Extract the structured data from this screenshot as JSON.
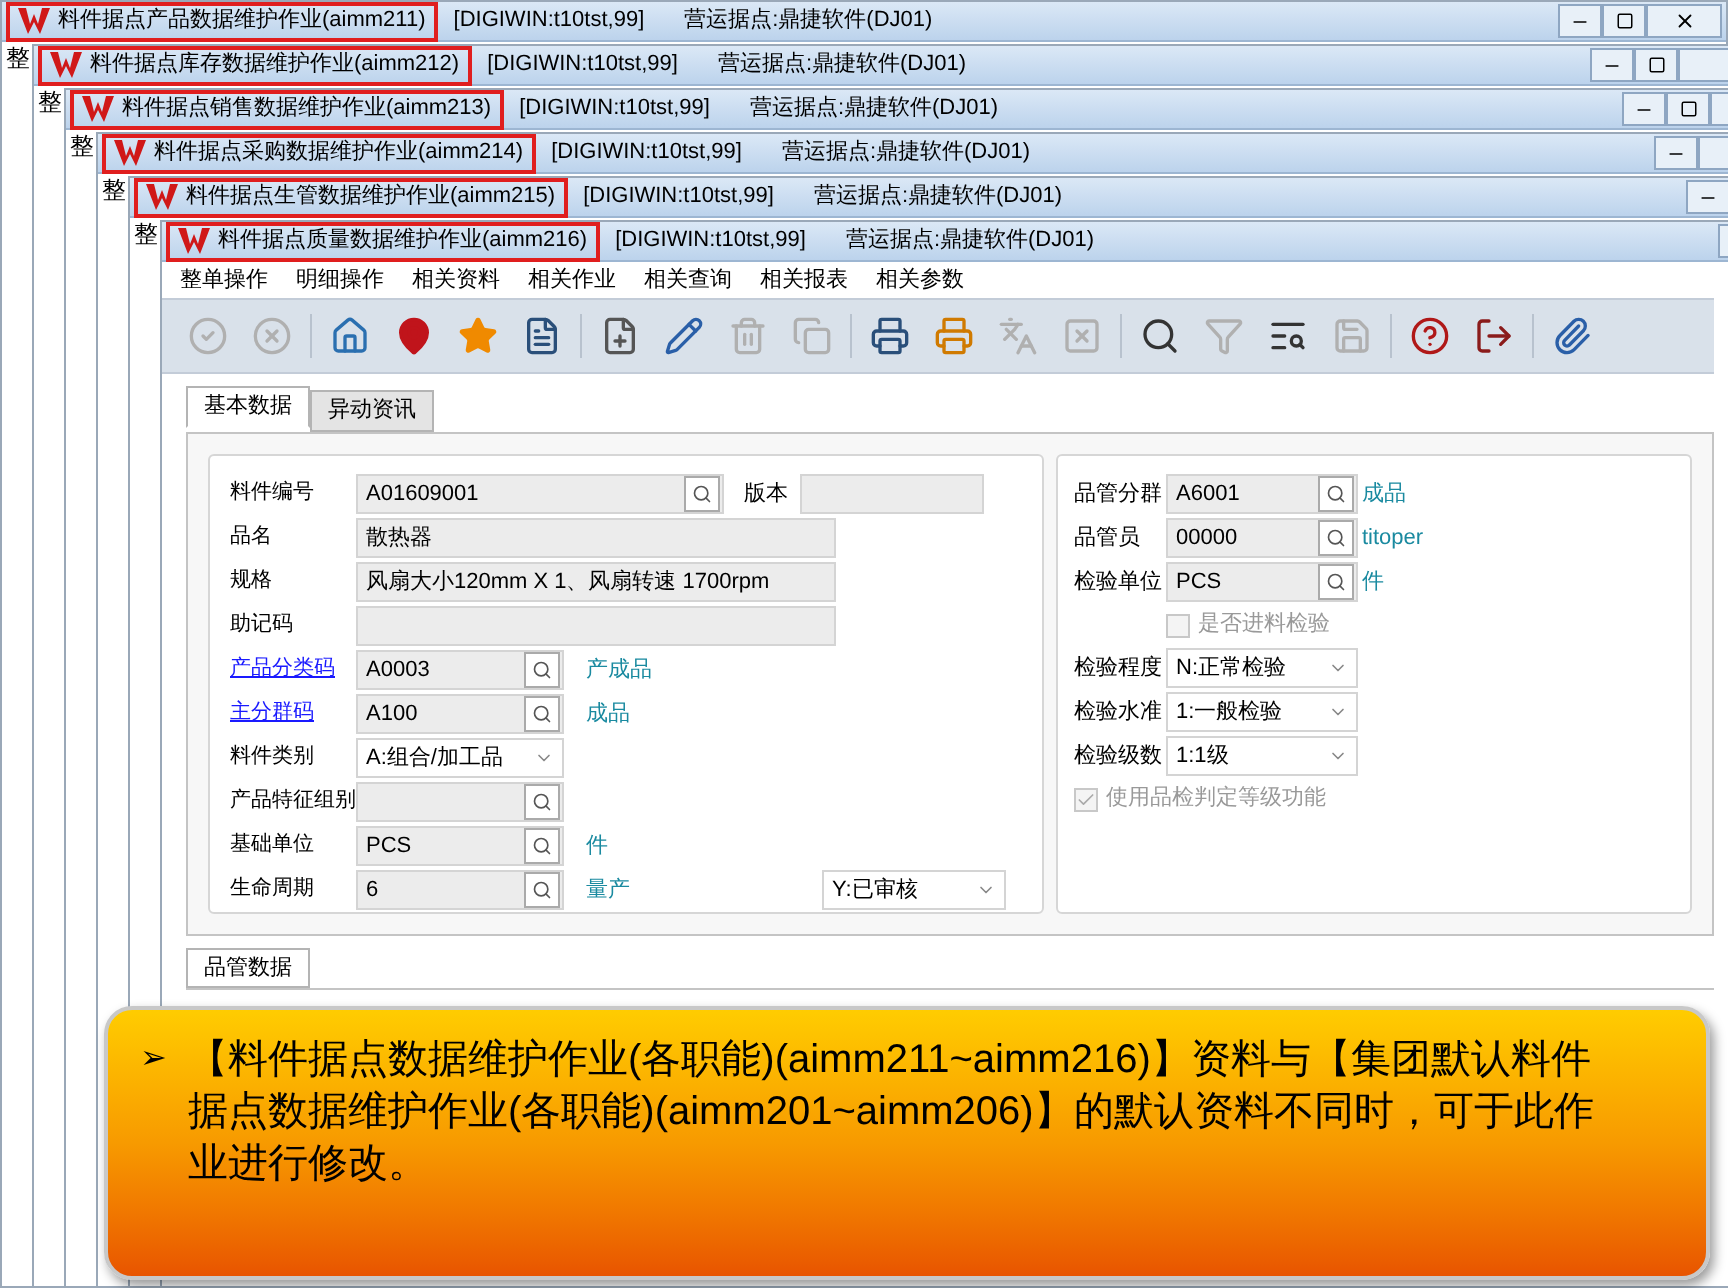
{
  "windows": [
    {
      "title": "料件据点产品数据维护作业(aimm211)",
      "server": "[DIGIWIN:t10tst,99]",
      "site": "营运据点:鼎捷软件(DJ01)",
      "menu_peek": "整"
    },
    {
      "title": "料件据点库存数据维护作业(aimm212)",
      "server": "[DIGIWIN:t10tst,99]",
      "site": "营运据点:鼎捷软件(DJ01)",
      "menu_peek": "整"
    },
    {
      "title": "料件据点销售数据维护作业(aimm213)",
      "server": "[DIGIWIN:t10tst,99]",
      "site": "营运据点:鼎捷软件(DJ01)",
      "menu_peek": "整"
    },
    {
      "title": "料件据点采购数据维护作业(aimm214)",
      "server": "[DIGIWIN:t10tst,99]",
      "site": "营运据点:鼎捷软件(DJ01)",
      "menu_peek": "整"
    },
    {
      "title": "料件据点生管数据维护作业(aimm215)",
      "server": "[DIGIWIN:t10tst,99]",
      "site": "营运据点:鼎捷软件(DJ01)",
      "menu_peek": "整"
    },
    {
      "title": "料件据点质量数据维护作业(aimm216)",
      "server": "[DIGIWIN:t10tst,99]",
      "site": "营运据点:鼎捷软件(DJ01)"
    }
  ],
  "menu": [
    "整单操作",
    "明细操作",
    "相关资料",
    "相关作业",
    "相关查询",
    "相关报表",
    "相关参数"
  ],
  "toolbar": [
    [
      {
        "disabled": true
      },
      {
        "disabled": true
      }
    ],
    [
      {
        "disabled": false
      },
      {
        "disabled": false
      },
      {
        "disabled": false
      },
      {
        "disabled": false
      }
    ],
    [
      {
        "disabled": false
      },
      {
        "disabled": false
      },
      {
        "disabled": true
      },
      {
        "disabled": true
      }
    ],
    [
      {
        "disabled": false
      },
      {
        "disabled": false
      },
      {
        "disabled": true
      },
      {
        "disabled": true
      }
    ],
    [
      {
        "disabled": false
      },
      {
        "disabled": true
      },
      {
        "disabled": false
      },
      {
        "disabled": true
      }
    ],
    [
      {
        "disabled": false
      },
      {
        "disabled": false
      }
    ],
    [
      {
        "disabled": false
      }
    ]
  ],
  "tabs": [
    {
      "label": "基本数据",
      "selected": true
    },
    {
      "label": "异动资讯",
      "selected": false
    }
  ],
  "left_form": [
    {
      "kind": "code",
      "label": "料件编号",
      "link": false,
      "value": "A01609001",
      "extra": {
        "label": "版本"
      }
    },
    {
      "kind": "wide",
      "label": "品名",
      "link": false,
      "value": "散热器"
    },
    {
      "kind": "wide",
      "label": "规格",
      "link": false,
      "value": "风扇大小120mm X 1、风扇转速 1700rpm"
    },
    {
      "kind": "wide",
      "label": "助记码",
      "link": false
    },
    {
      "kind": "lookup",
      "label": "产品分类码",
      "link": true,
      "value": "A0003",
      "desc": "产成品"
    },
    {
      "kind": "lookup",
      "label": "主分群码",
      "link": true,
      "value": "A100",
      "desc": "成品"
    },
    {
      "kind": "select",
      "label": "料件类别",
      "link": false,
      "value": "A:组合/加工品"
    },
    {
      "kind": "lookup",
      "label": "产品特征组别",
      "link": false
    },
    {
      "kind": "lookup",
      "label": "基础单位",
      "link": false,
      "value": "PCS",
      "desc": "件"
    },
    {
      "kind": "lookup",
      "label": "生命周期",
      "link": false,
      "value": "6",
      "desc": "量产",
      "status": "Y:已审核"
    }
  ],
  "right_form": [
    {
      "kind": "lookup",
      "label": "品管分群",
      "value": "A6001",
      "desc": "成品"
    },
    {
      "kind": "lookup",
      "label": "品管员",
      "value": "00000",
      "desc": "titoper"
    },
    {
      "kind": "lookup",
      "label": "检验单位",
      "value": "PCS",
      "desc": "件"
    },
    {
      "kind": "checkbox",
      "label": "是否进料检验",
      "checked": false,
      "disabled": true
    },
    {
      "kind": "select",
      "label": "检验程度",
      "value": "N:正常检验"
    },
    {
      "kind": "select",
      "label": "检验水准",
      "value": "1:一般检验"
    },
    {
      "kind": "select",
      "label": "检验级数",
      "value": "1:1级"
    },
    {
      "kind": "checkbox",
      "label": "使用品检判定等级功能",
      "checked": true,
      "disabled": true
    }
  ],
  "lower_tabs": [
    {
      "label": "品管数据",
      "selected": true
    }
  ],
  "callout": {
    "bullet": "➢",
    "text": "【料件据点数据维护作业(各职能)(aimm211~aimm216)】资料与【集团默认料件据点数据维护作业(各职能)(aimm201~aimm206)】的默认资料不同时，可于此作业进行修改。"
  }
}
